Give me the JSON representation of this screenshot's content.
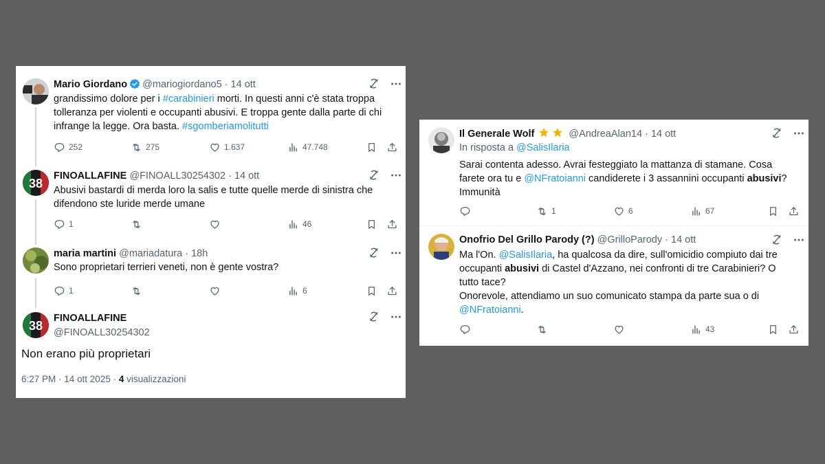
{
  "left": {
    "tweet1": {
      "name": "Mario Giordano",
      "handle": "@mariogiordano5",
      "sep": "·",
      "date": "14 ott",
      "body_pre": "grandissimo dolore per i ",
      "hashtag1": "#carabinieri",
      "body_mid": " morti. In questi anni c'è stata troppa tolleranza per violenti e occupanti abusivi. E troppa gente dalla parte di chi infrange la legge. Ora basta. ",
      "hashtag2": "#sgomberiamolitutti",
      "replies": "252",
      "reposts": "275",
      "likes": "1.637",
      "views": "47.748"
    },
    "tweet2": {
      "name": "FINOALLAFINE",
      "handle": "@FINOALL30254302",
      "sep": "·",
      "date": "14 ott",
      "body": "Abusivi bastardi di merda loro la salis e tutte quelle merde di sinistra che difendono ste luride merde umane",
      "replies": "1",
      "views": "46"
    },
    "tweet3": {
      "name": "maria martini",
      "handle": "@mariadatura",
      "sep": "·",
      "date": "18h",
      "body": "Sono proprietari terrieri veneti, non è gente vostra?",
      "replies": "1",
      "views": "6"
    },
    "tweet4": {
      "name": "FINOALLAFINE",
      "handle": "@FINOALL30254302",
      "body": "Non erano più proprietari",
      "time": "6:27 PM · 14 ott 2025 ·",
      "views_count": "4",
      "views_label": "visualizzazioni"
    }
  },
  "right": {
    "tweet1": {
      "name": "Il Generale Wolf",
      "handle": "@AndreaAlan14",
      "sep": "·",
      "date": "14 ott",
      "reply_to_label": "In risposta a",
      "reply_to_handle": "@SalisIlaria",
      "body_pre": "Sarai contenta adesso. Avrai festeggiato la mattanza di stamane. Cosa farete ora tu e ",
      "mention": "@NFratoianni",
      "body_mid": " candiderete i 3 assannini occupanti ",
      "body_bold": "abusivi",
      "body_post": "? Immunità",
      "reposts": "1",
      "likes": "6",
      "views": "67"
    },
    "tweet2": {
      "name": "Onofrio Del Grillo Parody (?)",
      "handle": "@GrilloParody",
      "sep": "·",
      "date": "14 ott",
      "body_pre": "Ma l'On. ",
      "mention1": "@SalisIlaria",
      "body_mid": ", ha qualcosa da dire, sull'omicidio compiuto dai tre occupanti ",
      "body_bold": "abusivi",
      "body_mid2": " di Castel d'Azzano, nei confronti di tre Carabinieri? O tutto tace?",
      "body_line2": "Onorevole, attendiamo un suo comunicato stampa da parte sua o di ",
      "mention2": "@NFratoianni",
      "body_end": ".",
      "views": "43"
    }
  },
  "colors": {
    "link": "#1d9bf0",
    "verified": "#1d9bf0",
    "star": "#f4b400",
    "background": "#5f5f5f"
  }
}
